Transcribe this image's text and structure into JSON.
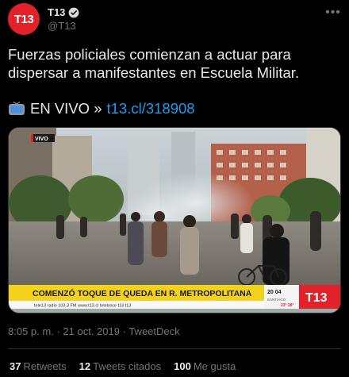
{
  "author": {
    "display_name": "T13",
    "handle": "@T13",
    "avatar_text": "T13",
    "verified": true
  },
  "tweet": {
    "text": "Fuerzas policiales comienzan a actuar para dispersar a manifestantes en Escuela Militar.",
    "live_label": "EN VIVO »",
    "link": "t13.cl/318908"
  },
  "media": {
    "live_tag": "VIVO",
    "banner_text": "COMENZÓ TOQUE DE QUEDA EN R. METROPOLITANA",
    "ticker_text": "tele13 radio 103.3 FM   www.t13.cl   teletrece   t13   t13",
    "clock": "20 04",
    "location": "SANTIAGO",
    "temperature": "23° 28°",
    "logo": "T13"
  },
  "meta": {
    "time": "8:05 p. m.",
    "separator": "·",
    "date": "21 oct. 2019",
    "source": "TweetDeck"
  },
  "stats": {
    "retweets_count": "37",
    "retweets_label": "Retweets",
    "quotes_count": "12",
    "quotes_label": "Tweets citados",
    "likes_count": "100",
    "likes_label": "Me gusta"
  },
  "colors": {
    "accent": "#1d9bf0",
    "brand_red": "#e3212b",
    "banner_yellow": "#f2d21b"
  }
}
